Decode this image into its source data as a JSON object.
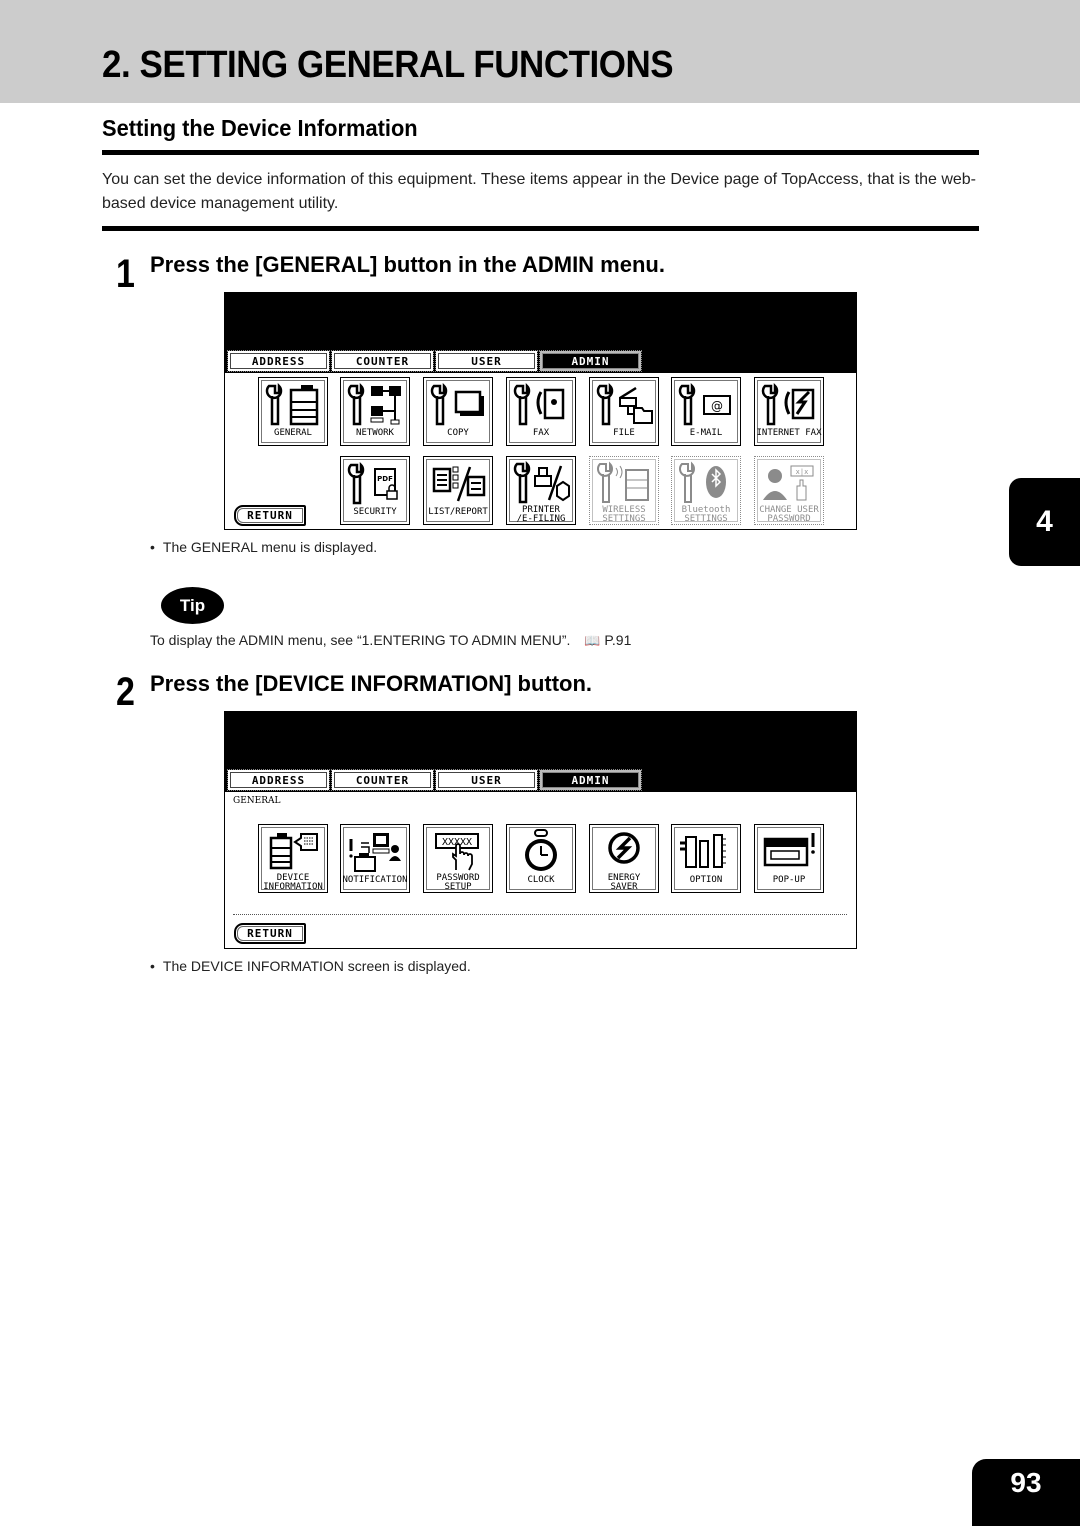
{
  "page": {
    "title": "2. SETTING GENERAL FUNCTIONS",
    "section_title": "Setting the Device Information",
    "intro": "You can set the device information of this equipment.  These items appear in the Device page of TopAccess, that is the web-based device management utility.",
    "chapter_tab": "4",
    "page_number": "93"
  },
  "steps": [
    {
      "number": "1",
      "text": "Press the [GENERAL] button in the ADMIN menu.",
      "result": "The GENERAL menu is displayed."
    },
    {
      "number": "2",
      "text": "Press the [DEVICE INFORMATION] button.",
      "result": "The DEVICE INFORMATION screen is displayed."
    }
  ],
  "tip": {
    "badge": "Tip",
    "text": "To display the ADMIN menu, see “1.ENTERING TO ADMIN MENU”.",
    "ref_icon": "book-icon",
    "ref_page": "P.91"
  },
  "panel1": {
    "tabs": [
      {
        "label": "ADDRESS",
        "active": false
      },
      {
        "label": "COUNTER",
        "active": false
      },
      {
        "label": "USER",
        "active": false
      },
      {
        "label": "ADMIN",
        "active": true
      }
    ],
    "buttons_row1": [
      {
        "label": "GENERAL",
        "icon": "wrench-copier-icon",
        "enabled": true
      },
      {
        "label": "NETWORK",
        "icon": "wrench-network-icon",
        "enabled": true
      },
      {
        "label": "COPY",
        "icon": "wrench-copy-icon",
        "enabled": true
      },
      {
        "label": "FAX",
        "icon": "wrench-fax-icon",
        "enabled": true
      },
      {
        "label": "FILE",
        "icon": "wrench-file-icon",
        "enabled": true
      },
      {
        "label": "E-MAIL",
        "icon": "wrench-email-icon",
        "enabled": true
      },
      {
        "label": "INTERNET FAX",
        "icon": "wrench-internet-fax-icon",
        "enabled": true
      }
    ],
    "buttons_row2": [
      {
        "label": "SECURITY",
        "icon": "wrench-pdf-lock-icon",
        "enabled": true
      },
      {
        "label": "LIST/REPORT",
        "icon": "list-report-icon",
        "enabled": true
      },
      {
        "label": "PRINTER\n/E-FILING",
        "icon": "wrench-printer-icon",
        "enabled": true
      },
      {
        "label": "WIRELESS\nSETTINGS",
        "icon": "wrench-wireless-icon",
        "enabled": false
      },
      {
        "label": "Bluetooth\nSETTINGS",
        "icon": "wrench-bluetooth-icon",
        "enabled": false
      },
      {
        "label": "CHANGE USER\nPASSWORD",
        "icon": "user-password-icon",
        "enabled": false
      }
    ],
    "return_label": "RETURN"
  },
  "panel2": {
    "tabs": [
      {
        "label": "ADDRESS",
        "active": false
      },
      {
        "label": "COUNTER",
        "active": false
      },
      {
        "label": "USER",
        "active": false
      },
      {
        "label": "ADMIN",
        "active": true
      }
    ],
    "breadcrumb": "GENERAL",
    "buttons": [
      {
        "label": "DEVICE\nINFORMATION",
        "icon": "device-information-icon"
      },
      {
        "label": "NOTIFICATION",
        "icon": "notification-icon"
      },
      {
        "label": "PASSWORD SETUP",
        "icon": "password-setup-icon"
      },
      {
        "label": "CLOCK",
        "icon": "stopwatch-icon"
      },
      {
        "label": "ENERGY\nSAVER",
        "icon": "energy-saver-icon"
      },
      {
        "label": "OPTION",
        "icon": "option-icon"
      },
      {
        "label": "POP-UP",
        "icon": "popup-icon"
      }
    ],
    "return_label": "RETURN"
  }
}
